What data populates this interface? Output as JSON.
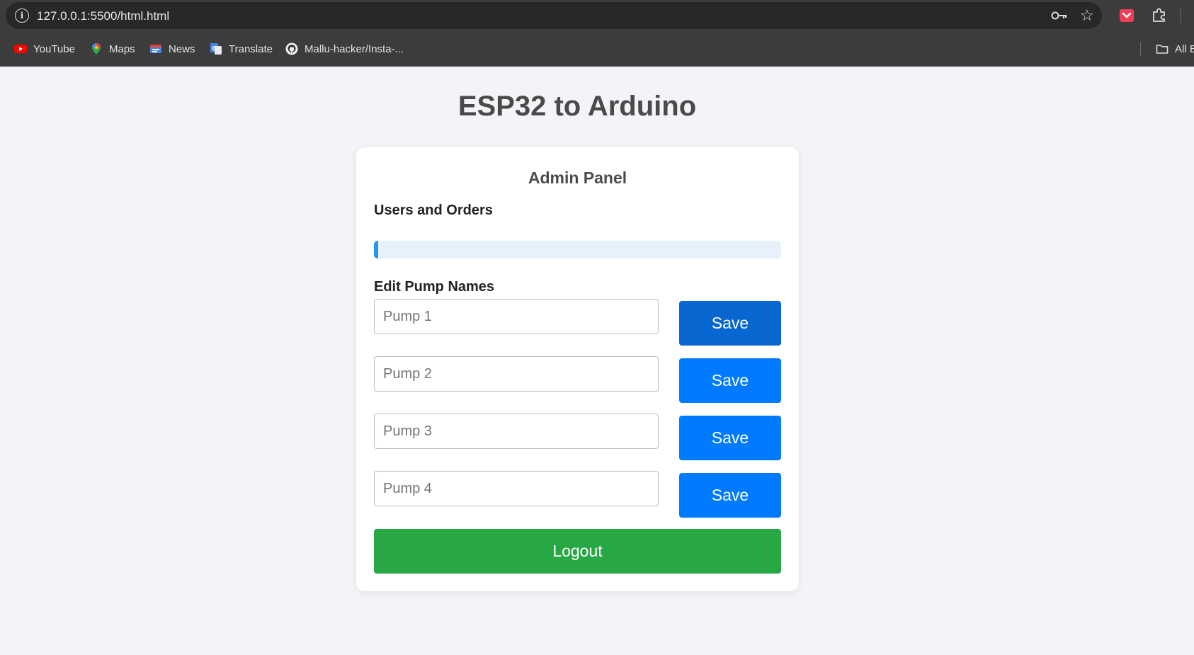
{
  "browser": {
    "url": "127.0.0.1:5500/html.html",
    "bookmarks": [
      {
        "label": "YouTube",
        "icon": "youtube-icon"
      },
      {
        "label": "Maps",
        "icon": "maps-icon"
      },
      {
        "label": "News",
        "icon": "news-icon"
      },
      {
        "label": "Translate",
        "icon": "translate-icon"
      },
      {
        "label": "Mallu-hacker/Insta-...",
        "icon": "github-icon"
      }
    ],
    "all_bookmarks_label": "All B"
  },
  "page": {
    "title": "ESP32 to Arduino"
  },
  "admin": {
    "title": "Admin Panel",
    "users_orders_title": "Users and Orders",
    "progress_fraction": 0.01,
    "edit_title": "Edit Pump Names",
    "pumps": [
      {
        "placeholder": "Pump 1",
        "save_label": "Save"
      },
      {
        "placeholder": "Pump 2",
        "save_label": "Save"
      },
      {
        "placeholder": "Pump 3",
        "save_label": "Save"
      },
      {
        "placeholder": "Pump 4",
        "save_label": "Save"
      }
    ],
    "logout_label": "Logout"
  },
  "colors": {
    "primary": "#007bff",
    "primary_active": "#0866d0",
    "success": "#28a745",
    "progress": "#2196f3",
    "progress_track": "#e6f1fc"
  }
}
